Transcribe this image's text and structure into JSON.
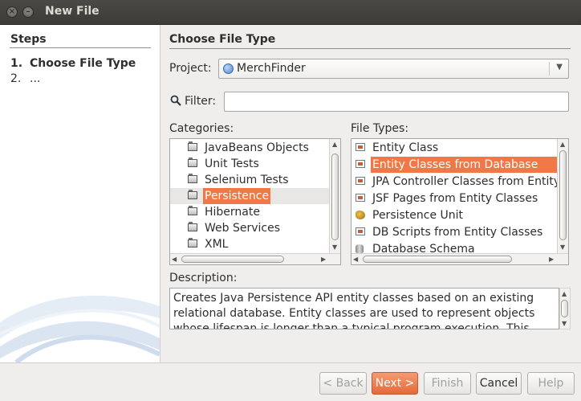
{
  "window": {
    "title": "New File"
  },
  "steps": {
    "heading": "Steps",
    "items": [
      {
        "num": "1.",
        "label": "Choose File Type"
      },
      {
        "num": "2.",
        "label": "..."
      }
    ]
  },
  "main": {
    "heading": "Choose File Type",
    "project_label": "Project:",
    "project_value": "MerchFinder",
    "filter_label": "Filter:",
    "filter_value": "",
    "categories_label": "Categories:",
    "categories": [
      "JavaBeans Objects",
      "Unit Tests",
      "Selenium Tests",
      "Persistence",
      "Hibernate",
      "Web Services",
      "XML"
    ],
    "selected_category": "Persistence",
    "filetypes_label": "File Types:",
    "filetypes": [
      "Entity Class",
      "Entity Classes from Database",
      "JPA Controller Classes from Entity",
      "JSF Pages from Entity Classes",
      "Persistence Unit",
      "DB Scripts from Entity Classes",
      "Database Schema"
    ],
    "selected_filetype": "Entity Classes from Database",
    "description_label": "Description:",
    "description": "Creates Java Persistence API entity classes based on an existing relational database. Entity classes are used to represent objects whose lifespan is longer than a typical program execution. This"
  },
  "buttons": {
    "back": "< Back",
    "next": "Next >",
    "finish": "Finish",
    "cancel": "Cancel",
    "help": "Help"
  },
  "colors": {
    "accent": "#f07746",
    "titlebar": "#3c3b37"
  }
}
